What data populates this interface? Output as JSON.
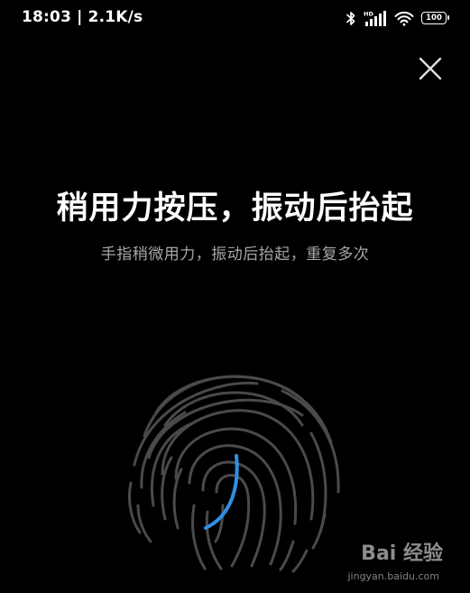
{
  "status_bar": {
    "time": "18:03",
    "separator": "|",
    "network_speed": "2.1K/s",
    "network_badge": "HD",
    "battery_level": "100",
    "icons": [
      "bluetooth-icon",
      "signal-icon",
      "wifi-icon",
      "battery-icon"
    ]
  },
  "close_icon": "close-icon",
  "title": "稍用力按压，振动后抬起",
  "subtitle": "手指稍微用力，振动后抬起，重复多次",
  "fingerprint": {
    "icon": "fingerprint-icon",
    "progress_color": "#2f8fe6",
    "ridge_color": "#4a4a4a"
  },
  "watermark": {
    "logo_text": "Bai 经验",
    "url": "jingyan.baidu.com"
  },
  "colors": {
    "background": "#000000",
    "title": "#ffffff",
    "subtitle": "#a6a6a6"
  }
}
